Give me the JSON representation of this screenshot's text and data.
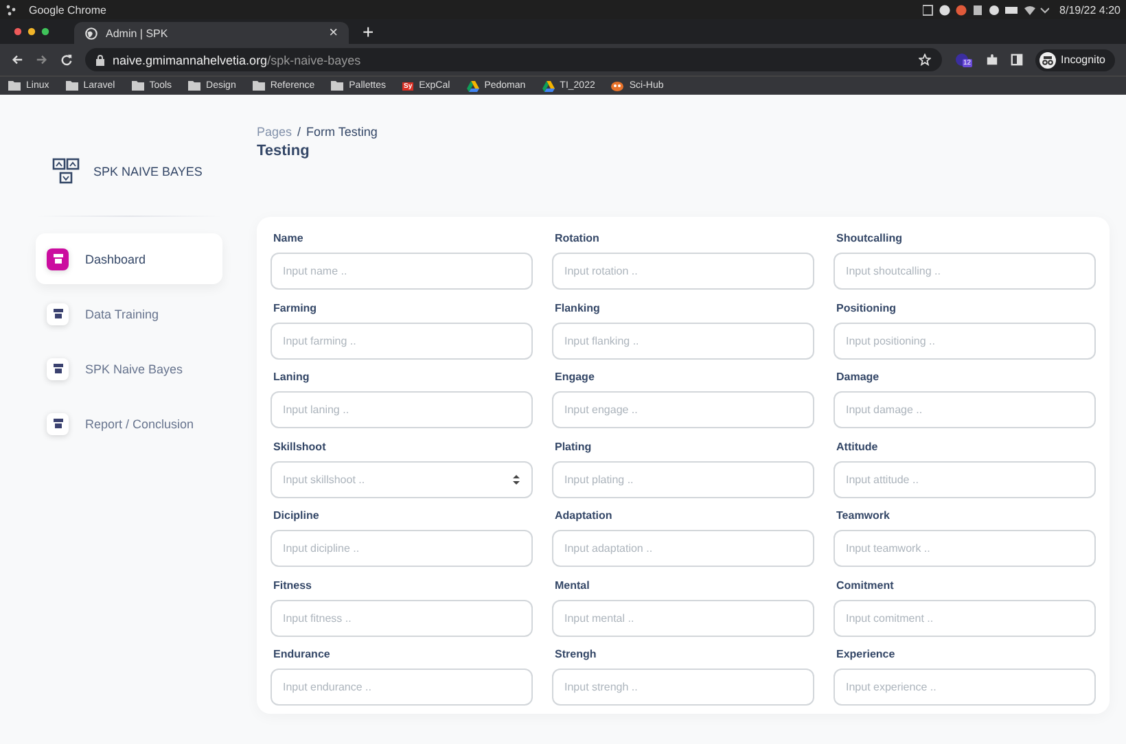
{
  "os_bar": {
    "app": "Google Chrome",
    "datetime": "8/19/22  4:20"
  },
  "browser": {
    "tab": {
      "title": "Admin | SPK"
    },
    "new_tab": "+",
    "tab_close": "×",
    "url_host": "naive.gmimannahelvetia.org",
    "url_path": "/spk-naive-bayes",
    "extension_badge": "12",
    "profile": "Incognito",
    "bookmarks": [
      {
        "label": "Linux",
        "kind": "folder"
      },
      {
        "label": "Laravel",
        "kind": "folder"
      },
      {
        "label": "Tools",
        "kind": "folder"
      },
      {
        "label": "Design",
        "kind": "folder"
      },
      {
        "label": "Reference",
        "kind": "folder"
      },
      {
        "label": "Pallettes",
        "kind": "folder"
      },
      {
        "label": "ExpCal",
        "kind": "sy",
        "badge": "Sy"
      },
      {
        "label": "Pedoman",
        "kind": "drive"
      },
      {
        "label": "TI_2022",
        "kind": "drive"
      },
      {
        "label": "Sci-Hub",
        "kind": "scihub"
      }
    ]
  },
  "sidebar": {
    "brand": "SPK NAIVE BAYES",
    "items": [
      {
        "label": "Dashboard",
        "selected": true
      },
      {
        "label": "Data Training",
        "selected": false
      },
      {
        "label": "SPK Naive Bayes",
        "selected": false
      },
      {
        "label": "Report / Conclusion",
        "selected": false
      }
    ]
  },
  "breadcrumb": {
    "parent": "Pages",
    "separator": "/",
    "current": "Form Testing"
  },
  "page_title": "Testing",
  "fields": [
    {
      "label": "Name",
      "placeholder": "Input name ..",
      "kind": "text"
    },
    {
      "label": "Rotation",
      "placeholder": "Input rotation ..",
      "kind": "text"
    },
    {
      "label": "Shoutcalling",
      "placeholder": "Input shoutcalling ..",
      "kind": "text"
    },
    {
      "label": "Farming",
      "placeholder": "Input farming ..",
      "kind": "text"
    },
    {
      "label": "Flanking",
      "placeholder": "Input flanking ..",
      "kind": "text"
    },
    {
      "label": "Positioning",
      "placeholder": "Input positioning ..",
      "kind": "text"
    },
    {
      "label": "Laning",
      "placeholder": "Input laning ..",
      "kind": "text"
    },
    {
      "label": "Engage",
      "placeholder": "Input engage ..",
      "kind": "text"
    },
    {
      "label": "Damage",
      "placeholder": "Input damage ..",
      "kind": "text"
    },
    {
      "label": "Skillshoot",
      "placeholder": "Input skillshoot ..",
      "kind": "number"
    },
    {
      "label": "Plating",
      "placeholder": "Input plating ..",
      "kind": "text"
    },
    {
      "label": "Attitude",
      "placeholder": "Input attitude ..",
      "kind": "text"
    },
    {
      "label": "Dicipline",
      "placeholder": "Input dicipline ..",
      "kind": "text"
    },
    {
      "label": "Adaptation",
      "placeholder": "Input adaptation ..",
      "kind": "text"
    },
    {
      "label": "Teamwork",
      "placeholder": "Input teamwork ..",
      "kind": "text"
    },
    {
      "label": "Fitness",
      "placeholder": "Input fitness ..",
      "kind": "text"
    },
    {
      "label": "Mental",
      "placeholder": "Input mental ..",
      "kind": "text"
    },
    {
      "label": "Comitment",
      "placeholder": "Input comitment ..",
      "kind": "text"
    },
    {
      "label": "Endurance",
      "placeholder": "Input endurance ..",
      "kind": "text"
    },
    {
      "label": "Strengh",
      "placeholder": "Input strengh ..",
      "kind": "text"
    },
    {
      "label": "Experience",
      "placeholder": "Input experience ..",
      "kind": "text"
    }
  ]
}
